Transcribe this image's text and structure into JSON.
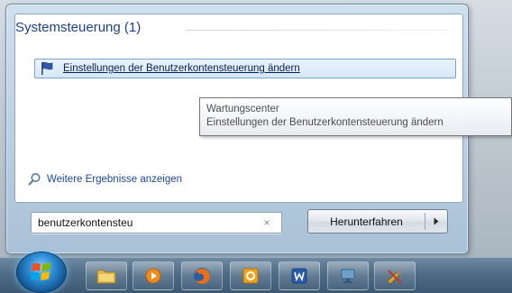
{
  "results": {
    "group_title": "Systemsteuerung (1)",
    "item_label": "Einstellungen der Benutzerkontensteuerung ändern",
    "item_icon": "flag-icon"
  },
  "tooltip": {
    "line1": "Wartungscenter",
    "line2": "Einstellungen der Benutzerkontensteuerung ändern"
  },
  "more_results": {
    "label": "Weitere Ergebnisse anzeigen",
    "icon": "search-icon"
  },
  "search": {
    "value": "benutzerkontensteu",
    "clear_glyph": "×"
  },
  "shutdown": {
    "label": "Herunterfahren",
    "arrow_glyph": "▸"
  },
  "taskbar": {
    "items": [
      {
        "icon": "windows-explorer-icon",
        "color": "#e0b84a"
      },
      {
        "icon": "media-player-icon",
        "color": "#f08a1c"
      },
      {
        "icon": "firefox-icon",
        "color": "#d9561b"
      },
      {
        "icon": "outlook-icon",
        "color": "#f0a21c"
      },
      {
        "icon": "word-icon",
        "color": "#2b5ba8"
      },
      {
        "icon": "network-icon",
        "color": "#6ea0c8"
      },
      {
        "icon": "tools-icon",
        "color": "#d2a23c"
      }
    ]
  },
  "colors": {
    "accent": "#1e3f8a",
    "link": "#1d4798"
  }
}
